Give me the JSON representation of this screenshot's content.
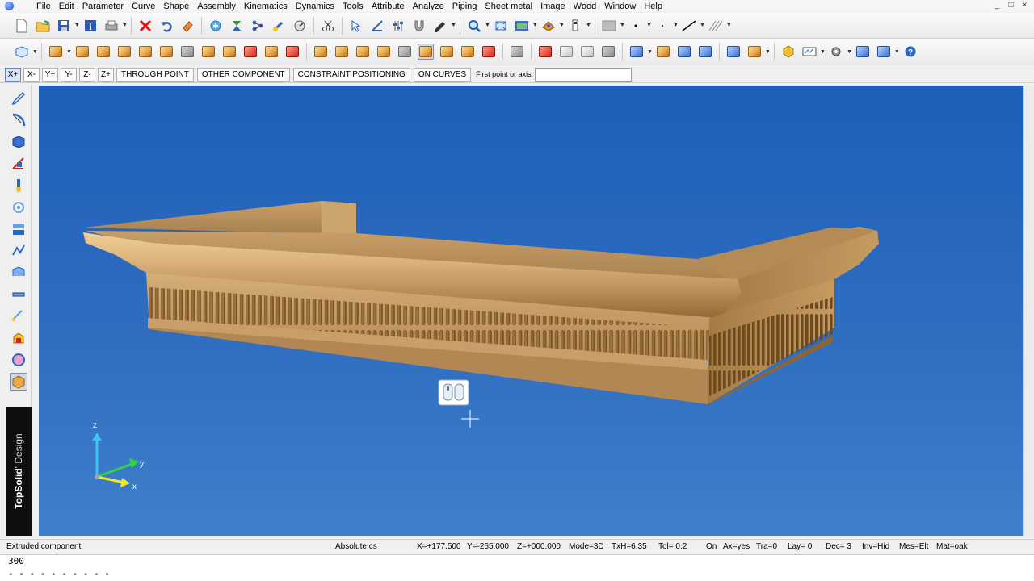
{
  "menu": [
    "File",
    "Edit",
    "Parameter",
    "Curve",
    "Shape",
    "Assembly",
    "Kinematics",
    "Dynamics",
    "Tools",
    "Attribute",
    "Analyze",
    "Piping",
    "Sheet metal",
    "Image",
    "Wood",
    "Window",
    "Help"
  ],
  "window_controls": [
    "_",
    "□",
    "×"
  ],
  "optbar": {
    "axis_buttons": [
      "X+",
      "X-",
      "Y+",
      "Y-",
      "Z-",
      "Z+"
    ],
    "mode_buttons": [
      "THROUGH POINT",
      "OTHER COMPONENT",
      "CONSTRAINT POSITIONING",
      "ON CURVES"
    ],
    "prompt_label": "First point or axis:",
    "prompt_value": ""
  },
  "brand": {
    "name": "TopSolid",
    "suffix": "' Design"
  },
  "axes": {
    "z": "z",
    "y": "y",
    "x": "x"
  },
  "statusbar": {
    "message": "Extruded component.",
    "cs": "Absolute cs",
    "x": "X=+177.500",
    "y": "Y=-265.000",
    "z": "Z=+000.000",
    "mode": "Mode=3D",
    "txh": "TxH=6.35",
    "tol": "Tol=  0.2",
    "on": "On",
    "ax": "Ax=yes",
    "tra": "Tra=0",
    "lay": "Lay=  0",
    "dec": "Dec= 3",
    "inv": "Inv=Hid",
    "mes": "Mes=Elt",
    "mat": "Mat=oak"
  },
  "command": {
    "line1": "300",
    "line2": "- - - - - - - - - -"
  },
  "colors": {
    "viewport": "#1c5fb9",
    "wood_light": "#e0b57a",
    "wood_dark": "#9c6b36",
    "axis_z": "#39c8f0",
    "axis_y": "#35d04a",
    "axis_x": "#f2e91c"
  }
}
